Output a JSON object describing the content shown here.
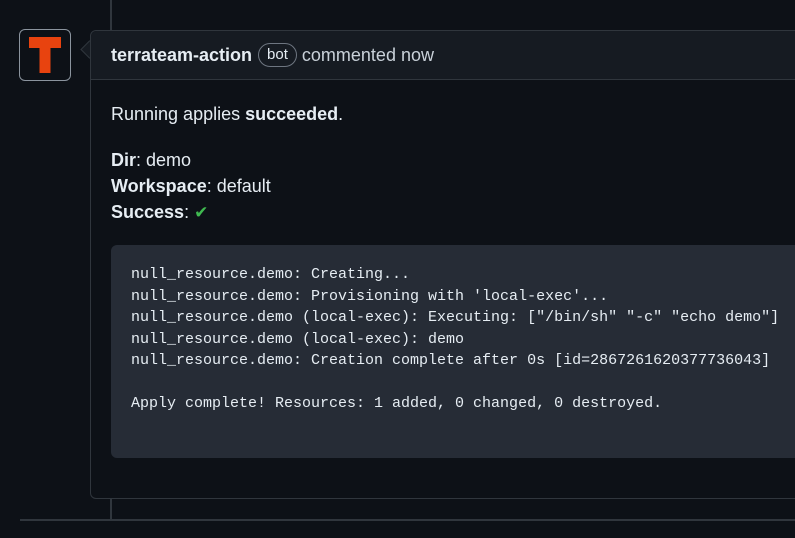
{
  "comment": {
    "author": "terrateam-action",
    "badge": "bot",
    "action_text": "commented now",
    "intro_prefix": "Running applies ",
    "intro_bold": "succeeded",
    "intro_suffix": ".",
    "fields": [
      {
        "label": "Dir",
        "value": ": demo"
      },
      {
        "label": "Workspace",
        "value": ": default"
      },
      {
        "label": "Success",
        "value": ": "
      }
    ],
    "success_icon": "check-mark-icon",
    "success_glyph": "✔",
    "code_lines": [
      "null_resource.demo: Creating...",
      "null_resource.demo: Provisioning with 'local-exec'...",
      "null_resource.demo (local-exec): Executing: [\"/bin/sh\" \"-c\" \"echo demo\"]",
      "null_resource.demo (local-exec): demo",
      "null_resource.demo: Creation complete after 0s [id=2867261620377736043]",
      "",
      "Apply complete! Resources: 1 added, 0 changed, 0 destroyed."
    ]
  },
  "avatar": {
    "icon": "terrateam-logo-icon",
    "letter_color": "#e8430f"
  }
}
